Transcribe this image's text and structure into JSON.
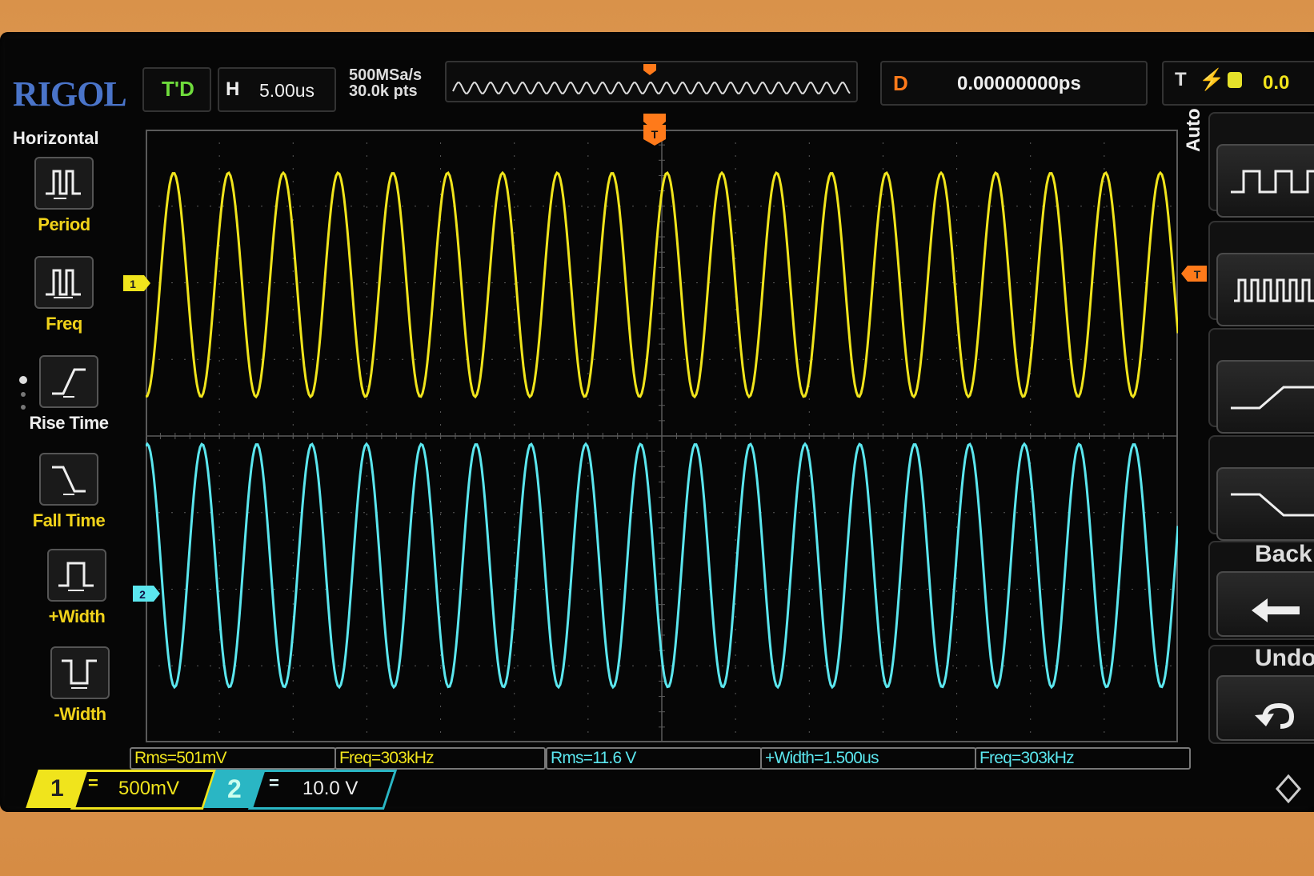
{
  "brand": "RIGOL",
  "header": {
    "trigger_mode": "T'D",
    "horizontal_label": "H",
    "timebase": "5.00us",
    "sample_rate": "500MSa/s",
    "memory_depth": "30.0k pts",
    "delay_label": "D",
    "delay_value": "0.00000000ps",
    "trigger_label": "T",
    "trigger_level": "0.0"
  },
  "menu": {
    "title": "Horizontal",
    "items": [
      {
        "label": "Period",
        "icon": "period-icon"
      },
      {
        "label": "Freq",
        "icon": "frequency-icon"
      },
      {
        "label": "Rise Time",
        "icon": "rise-time-icon"
      },
      {
        "label": "Fall Time",
        "icon": "fall-time-icon"
      },
      {
        "label": "+Width",
        "icon": "positive-width-icon"
      },
      {
        "label": "-Width",
        "icon": "negative-width-icon"
      }
    ]
  },
  "right_panel": {
    "auto_label": "Auto",
    "back_label": "Back",
    "undo_label": "Undo"
  },
  "measurements": [
    {
      "text": "Rms=501mV",
      "channel": 1
    },
    {
      "text": "Freq=303kHz",
      "channel": 1
    },
    {
      "text": "Rms=11.6 V",
      "channel": 2
    },
    {
      "text": "+Width=1.500us",
      "channel": 2
    },
    {
      "text": "Freq=303kHz",
      "channel": 2
    }
  ],
  "channels": [
    {
      "number": "1",
      "coupling": "=",
      "scale": "500mV",
      "color": "#f0e41c"
    },
    {
      "number": "2",
      "coupling": "=",
      "scale": "10.0 V",
      "color": "#5be6ee"
    }
  ],
  "markers": {
    "trigger": "T",
    "ch1": "1",
    "ch2": "2"
  },
  "colors": {
    "ch1": "#f0e41c",
    "ch2": "#5be6ee",
    "trigger": "#ff7a1a",
    "grid": "#5a5a5a"
  }
}
